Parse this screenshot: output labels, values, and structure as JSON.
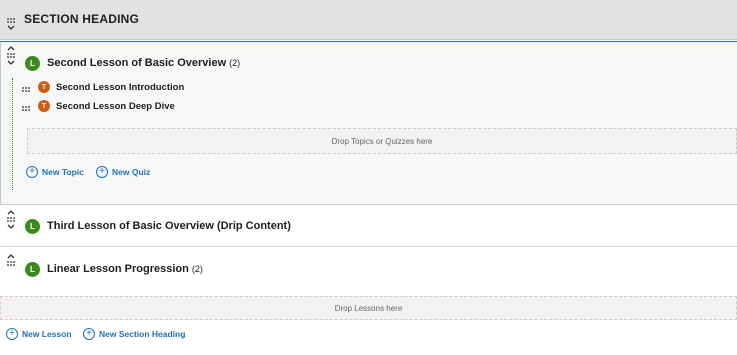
{
  "section": {
    "title": "SECTION HEADING"
  },
  "lessons": [
    {
      "badge": "L",
      "title": "Second Lesson of Basic Overview",
      "count": "(2)",
      "topics": [
        {
          "badge": "T",
          "title": "Second Lesson Introduction"
        },
        {
          "badge": "T",
          "title": "Second Lesson Deep Dive"
        }
      ],
      "drop_text": "Drop Topics or Quizzes here",
      "new_topic": "New Topic",
      "new_quiz": "New Quiz"
    },
    {
      "badge": "L",
      "title": "Third Lesson of Basic Overview (Drip Content)",
      "count": ""
    },
    {
      "badge": "L",
      "title": "Linear Lesson Progression",
      "count": "(2)"
    }
  ],
  "drop_lessons": "Drop Lessons here",
  "footer": {
    "new_lesson": "New Lesson",
    "new_section_heading": "New Section Heading"
  },
  "colors": {
    "lesson_badge": "#3c8a1c",
    "topic_badge": "#d05c12",
    "link": "#2271b1",
    "section_bg": "#e2e2e2"
  }
}
